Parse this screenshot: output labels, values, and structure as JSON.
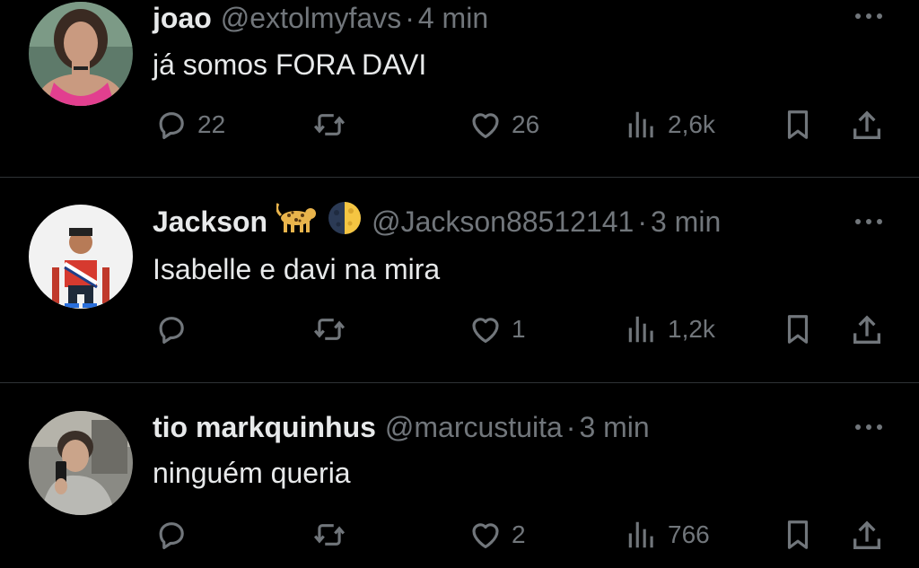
{
  "tweets": [
    {
      "name": "joao",
      "handle": "@extolmyfavs",
      "separator": "·",
      "time": "4 min",
      "text": "já somos FORA DAVI",
      "avatar": "woman-pink-top-avatar",
      "counts": {
        "reply": "22",
        "repost": "",
        "like": "26",
        "views": "2,6k"
      }
    },
    {
      "name": "Jackson",
      "badges": [
        "leopard-emoji",
        "half-moon-emoji"
      ],
      "handle": "@Jackson88512141",
      "separator": "·",
      "time": "3 min",
      "text": "Isabelle e davi na mira",
      "avatar": "cartoon-man-red-shirt-avatar",
      "counts": {
        "reply": "",
        "repost": "",
        "like": "1",
        "views": "1,2k"
      }
    },
    {
      "name": "tio markquinhus",
      "handle": "@marcustuita",
      "separator": "·",
      "time": "3 min",
      "text": "ninguém queria",
      "avatar": "person-selfie-avatar",
      "counts": {
        "reply": "",
        "repost": "",
        "like": "2",
        "views": "766"
      }
    }
  ],
  "icons": {
    "reply": "reply-bubble-icon",
    "repost": "repost-arrows-icon",
    "like": "heart-icon",
    "views": "views-bars-icon",
    "bookmark": "bookmark-icon",
    "share": "share-upload-icon",
    "more": "more-dots-icon"
  },
  "colors": {
    "background": "#000000",
    "text": "#e7e9ea",
    "muted": "#71767b",
    "divider": "#2f3336"
  }
}
